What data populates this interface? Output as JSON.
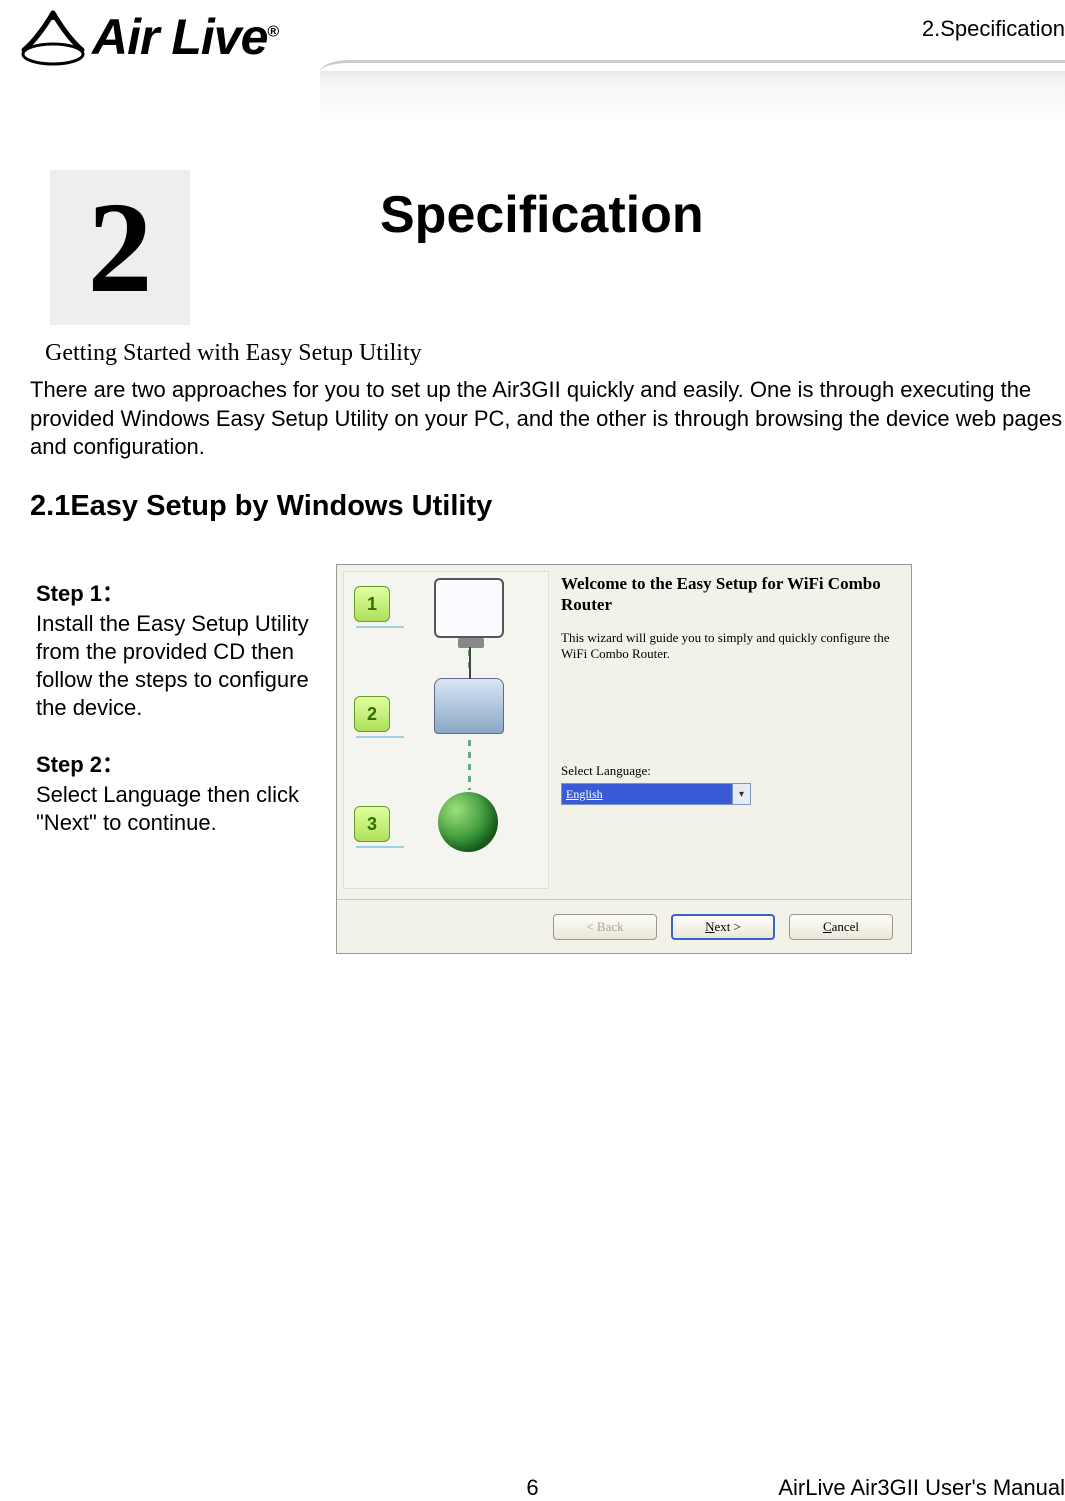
{
  "header": {
    "running_head": "2.Specification",
    "brand": "Air Live",
    "registered": "®"
  },
  "chapter": {
    "number": "2",
    "title": "Specification"
  },
  "subtitle": "Getting Started with Easy Setup Utility",
  "intro": "There are two approaches for you to set up the Air3GII quickly and easily. One is through executing the provided Windows Easy Setup Utility on your PC, and the other is through browsing the device web pages and configuration.",
  "section_heading": "2.1Easy Setup by Windows Utility",
  "steps": [
    {
      "label": "Step 1：",
      "body": "Install the Easy Setup Utility from the provided CD then follow the steps to configure the device."
    },
    {
      "label": "Step 2：",
      "body": "Select Language then click \"Next\" to continue."
    }
  ],
  "wizard": {
    "side_badges": [
      "1",
      "2",
      "3"
    ],
    "title": "Welcome to the Easy Setup for WiFi Combo Router",
    "description": "This wizard will guide you to simply and quickly configure the WiFi Combo Router.",
    "language_label": "Select Language:",
    "language_value": "English",
    "buttons": {
      "back": "< Back",
      "next_prefix": "N",
      "next_rest": "ext >",
      "cancel_prefix": "C",
      "cancel_rest": "ancel"
    }
  },
  "footer": {
    "page": "6",
    "doc": "AirLive Air3GII User's Manual"
  }
}
